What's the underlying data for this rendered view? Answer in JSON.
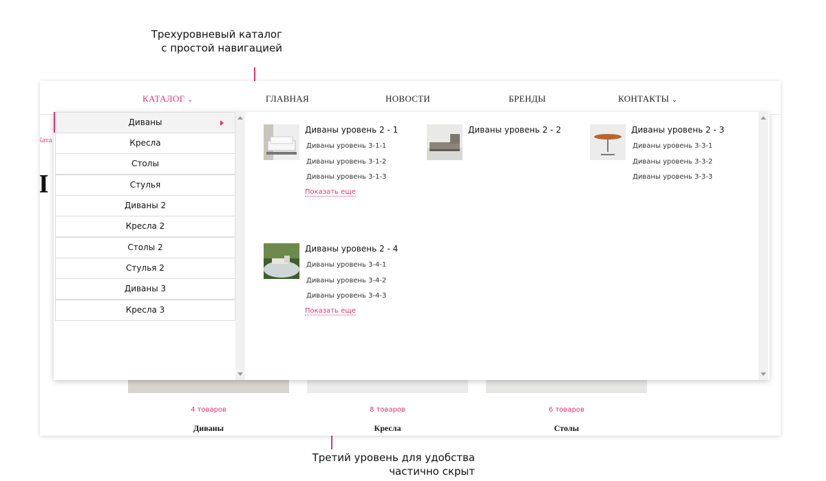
{
  "annotations": {
    "top": [
      "Трехуровневый каталог",
      "с простой навигацией"
    ],
    "bottom": [
      "Третий уровень для удобства",
      "частично скрыт"
    ]
  },
  "nav": {
    "catalog": "КАТАЛОГ",
    "home": "ГЛАВНАЯ",
    "news": "НОВОСТИ",
    "brands": "БРЕНДЫ",
    "contacts": "КОНТАКТЫ"
  },
  "background": {
    "breadcrumb": "Ката",
    "heading": "I",
    "cards": [
      {
        "count": "4 товаров",
        "name": "Диваны"
      },
      {
        "count": "8 товаров",
        "name": "Кресла"
      },
      {
        "count": "6 товаров",
        "name": "Столы"
      }
    ]
  },
  "menu": {
    "level1": [
      "Диваны",
      "Кресла",
      "Столы",
      "Стулья",
      "Диваны 2",
      "Кресла 2",
      "Столы 2",
      "Стулья 2",
      "Диваны 3",
      "Кресла 3"
    ],
    "groups": [
      {
        "title": "Диваны уровень 2 - 1",
        "links": [
          "Диваны уровень 3-1-1",
          "Диваны уровень 3-1-2",
          "Диваны уровень 3-1-3"
        ],
        "more": "Показать еще"
      },
      {
        "title": "Диваны уровень 2 - 2",
        "links": [],
        "more": ""
      },
      {
        "title": "Диваны уровень 2 - 3",
        "links": [
          "Диваны уровень 3-3-1",
          "Диваны уровень 3-3-2",
          "Диваны уровень 3-3-3"
        ],
        "more": ""
      },
      {
        "title": "Диваны уровень 2 - 4",
        "links": [
          "Диваны уровень 3-4-1",
          "Диваны уровень 3-4-2",
          "Диваны уровень 3-4-3"
        ],
        "more": "Показать еще"
      }
    ]
  },
  "colors": {
    "accent": "#e8316e"
  },
  "icons": {
    "dropdown": "chevron-down-icon",
    "active_item": "triangle-right-icon"
  }
}
